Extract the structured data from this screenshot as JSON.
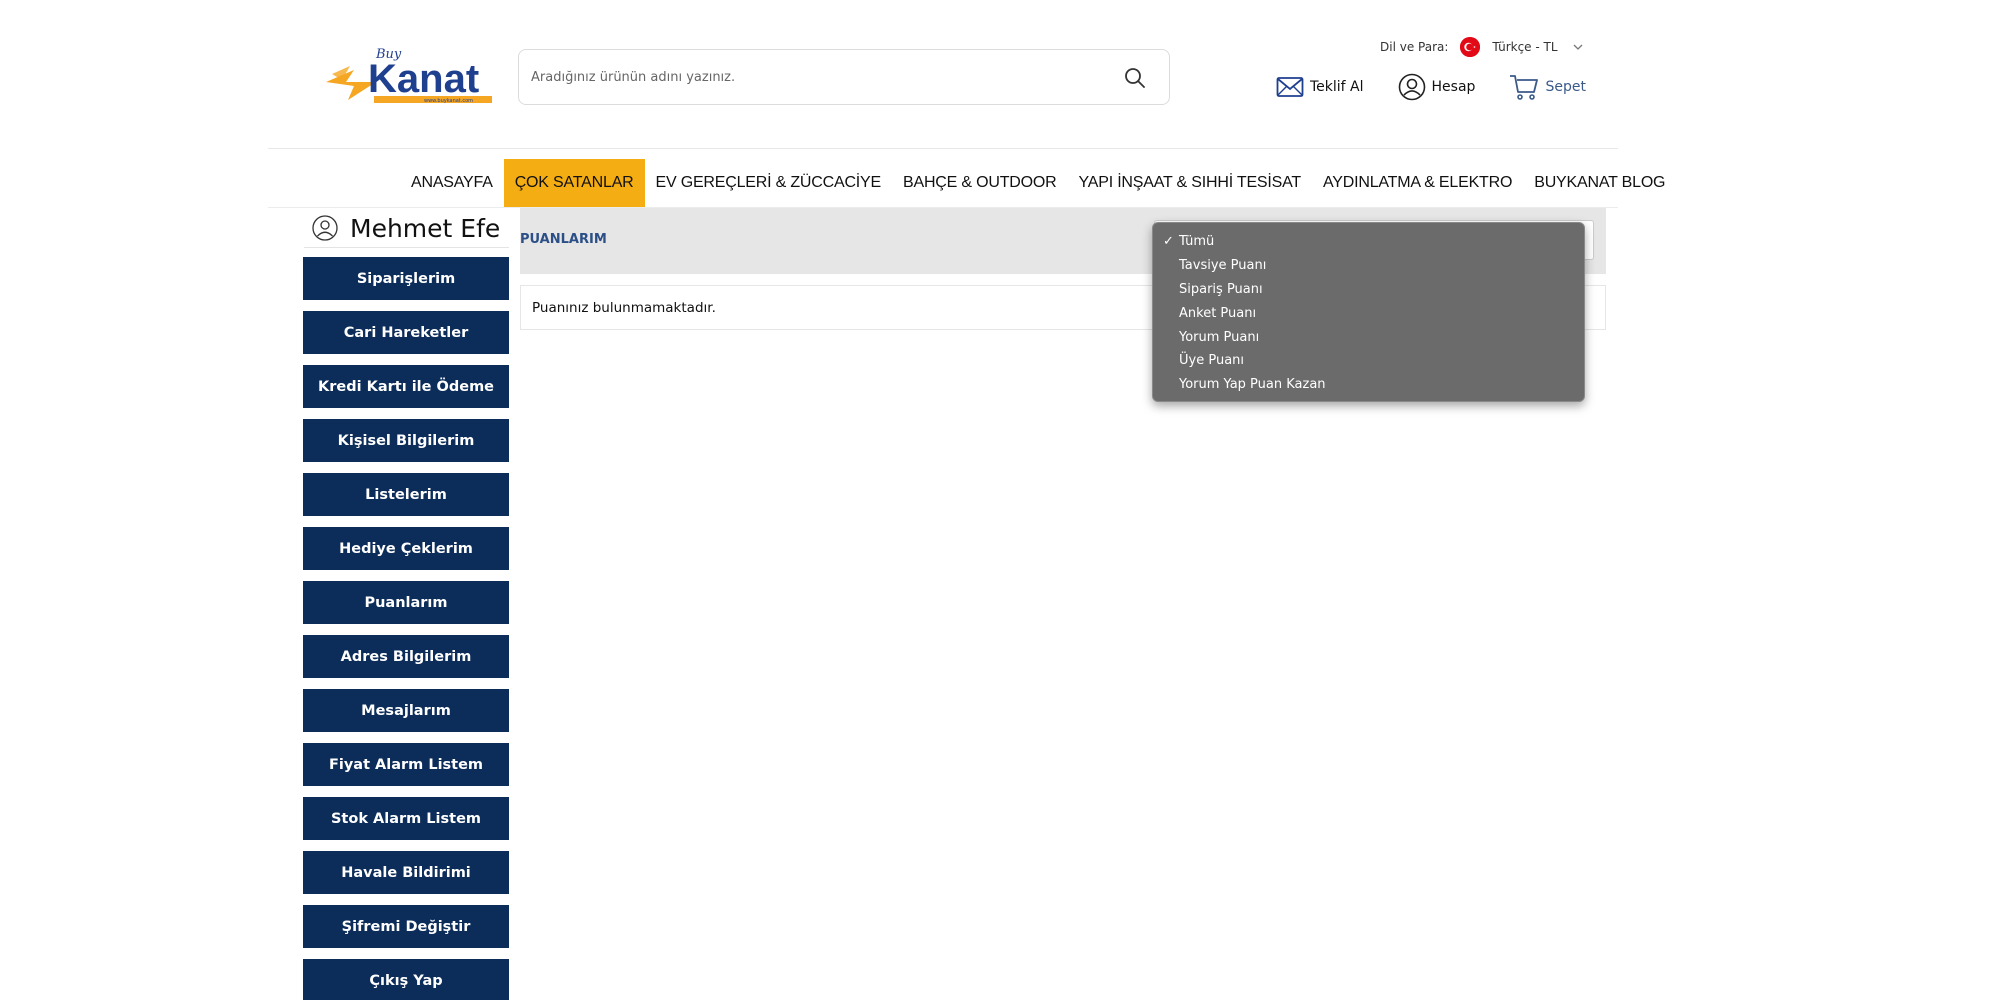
{
  "header": {
    "logo": {
      "brand": "Kanat",
      "tag": "Buy",
      "site": "www.buykanat.com"
    },
    "search": {
      "placeholder": "Aradığınız ürünün adını yazınız."
    },
    "lang": {
      "label": "Dil ve Para:",
      "value": "Türkçe - TL"
    },
    "actions": {
      "quote": "Teklif Al",
      "account": "Hesap",
      "cart": "Sepet"
    }
  },
  "nav": {
    "items": [
      "ANASAYFA",
      "ÇOK SATANLAR",
      "EV GEREÇLERİ & ZÜCCACİYE",
      "BAHÇE & OUTDOOR",
      "YAPI İNŞAAT & SIHHİ TESİSAT",
      "AYDINLATMA & ELEKTRO",
      "BUYKANAT BLOG"
    ],
    "active_index": 1
  },
  "sidebar": {
    "user_name": "Mehmet Efe",
    "items": [
      "Siparişlerim",
      "Cari Hareketler",
      "Kredi Kartı ile Ödeme",
      "Kişisel Bilgilerim",
      "Listelerim",
      "Hediye Çeklerim",
      "Puanlarım",
      "Adres Bilgilerim",
      "Mesajlarım",
      "Fiyat Alarm Listem",
      "Stok Alarm Listem",
      "Havale Bildirimi",
      "Şifremi Değiştir",
      "Çıkış Yap"
    ]
  },
  "content": {
    "title": "PUANLARIM",
    "empty_message": "Puanınız bulunmamaktadır."
  },
  "dropdown": {
    "selected_index": 0,
    "check_mark": "✓",
    "options": [
      "Tümü",
      "Tavsiye Puanı",
      "Sipariş Puanı",
      "Anket Puanı",
      "Yorum Puanı",
      "Üye Puanı",
      "Yorum Yap Puan Kazan"
    ]
  },
  "colors": {
    "accent": "#f5ad14",
    "sidebar_button": "#0c2c59",
    "title_blue": "#2b4f86",
    "logo_blue": "#1f3f8f",
    "logo_orange": "#f5a623"
  }
}
